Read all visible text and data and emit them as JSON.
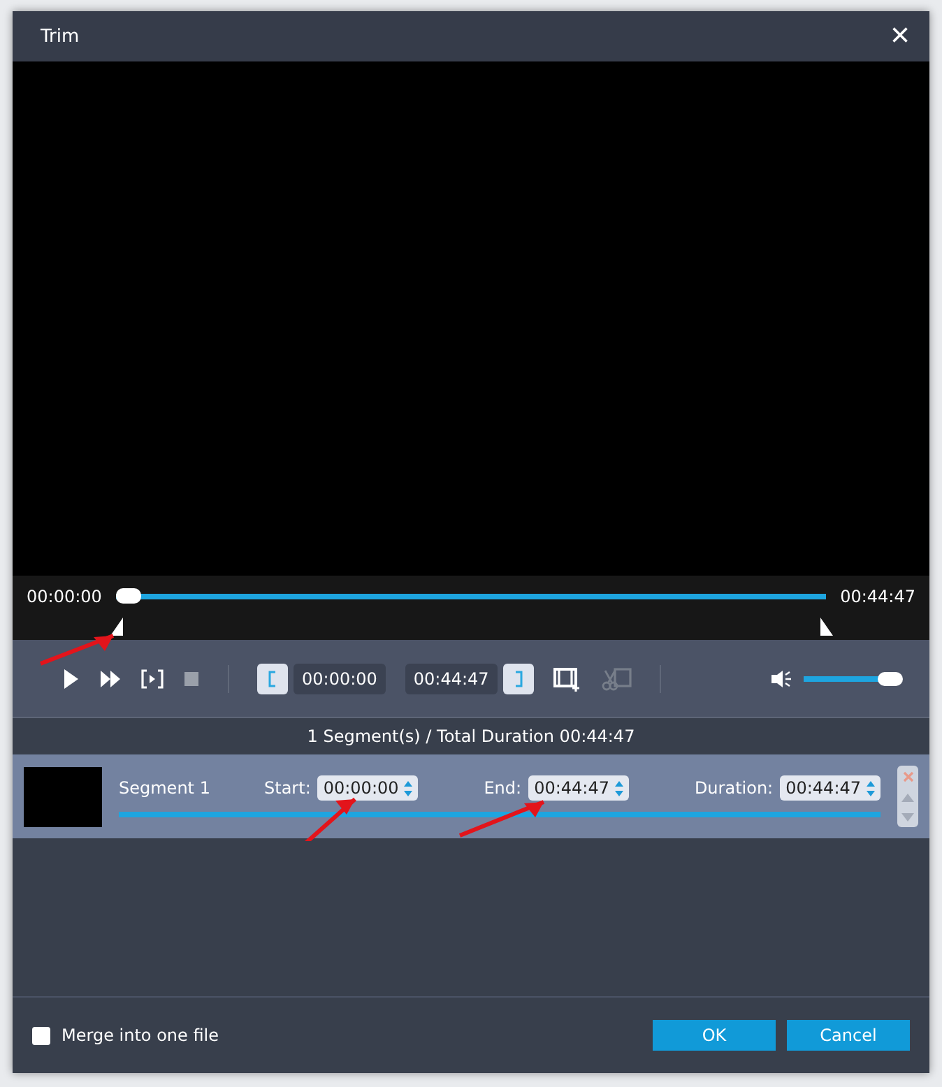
{
  "window": {
    "title": "Trim",
    "close": "×"
  },
  "timeline": {
    "start": "00:00:00",
    "end": "00:44:47",
    "level": 0
  },
  "controls": {
    "start_time": "00:00:00",
    "end_time": "00:44:47",
    "volume": {
      "level": 0.88
    }
  },
  "summary": "1 Segment(s) / Total Duration 00:44:47",
  "segments": [
    {
      "name": "Segment 1",
      "start_label": "Start:",
      "start": "00:00:00",
      "end_label": "End:",
      "end": "00:44:47",
      "duration_label": "Duration:",
      "duration": "00:44:47",
      "selected": true
    }
  ],
  "merge": {
    "label": "Merge into one file",
    "checked": false
  },
  "buttons": [
    {
      "label": "OK",
      "kind": "primary"
    },
    {
      "label": "Cancel",
      "kind": "primary"
    }
  ]
}
